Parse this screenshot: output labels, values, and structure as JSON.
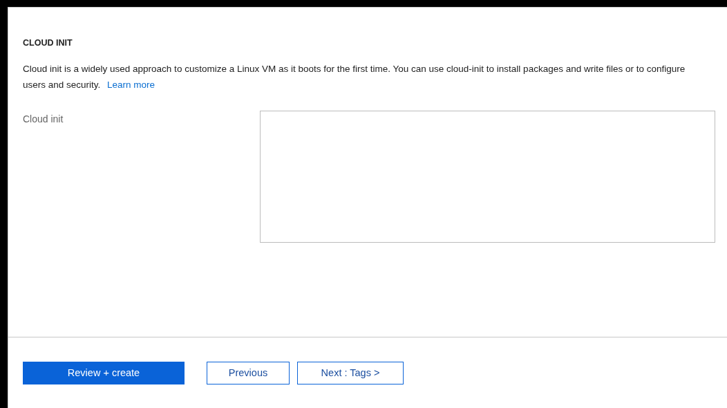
{
  "section": {
    "heading": "CLOUD INIT",
    "description": "Cloud init is a widely used approach to customize a Linux VM as it boots for the first time. You can use cloud-init to install packages and write files or to configure users and security.",
    "link": "Learn more"
  },
  "field": {
    "label": "Cloud init"
  },
  "buttons": [
    {
      "label": "Review + create",
      "kind": "primary"
    },
    {
      "label": "Previous",
      "kind": "secondary"
    },
    {
      "label": "Next : Tags >",
      "kind": "secondary"
    }
  ]
}
